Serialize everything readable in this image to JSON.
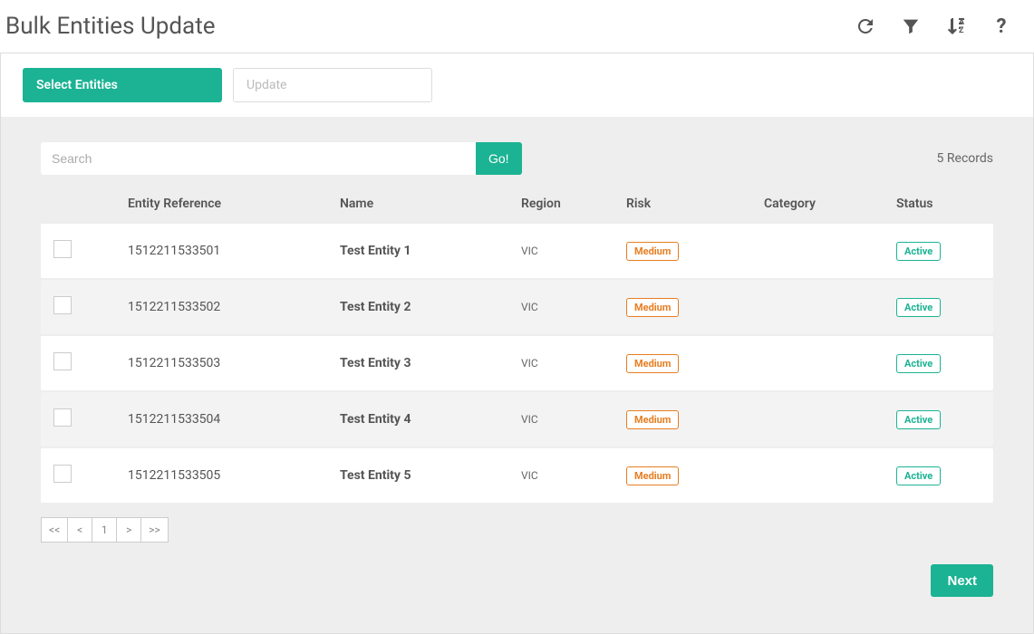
{
  "header": {
    "title": "Bulk Entities Update"
  },
  "tabs": {
    "select": "Select Entities",
    "update": "Update"
  },
  "search": {
    "placeholder": "Search",
    "go_label": "Go!"
  },
  "records_text": "5 Records",
  "columns": {
    "entity_reference": "Entity Reference",
    "name": "Name",
    "region": "Region",
    "risk": "Risk",
    "category": "Category",
    "status": "Status"
  },
  "rows": [
    {
      "ref": "1512211533501",
      "name": "Test Entity 1",
      "region": "VIC",
      "risk": "Medium",
      "category": "",
      "status": "Active"
    },
    {
      "ref": "1512211533502",
      "name": "Test Entity 2",
      "region": "VIC",
      "risk": "Medium",
      "category": "",
      "status": "Active"
    },
    {
      "ref": "1512211533503",
      "name": "Test Entity 3",
      "region": "VIC",
      "risk": "Medium",
      "category": "",
      "status": "Active"
    },
    {
      "ref": "1512211533504",
      "name": "Test Entity 4",
      "region": "VIC",
      "risk": "Medium",
      "category": "",
      "status": "Active"
    },
    {
      "ref": "1512211533505",
      "name": "Test Entity 5",
      "region": "VIC",
      "risk": "Medium",
      "category": "",
      "status": "Active"
    }
  ],
  "pagination": {
    "first": "<<",
    "prev": "<",
    "page": "1",
    "next": ">",
    "last": ">>"
  },
  "next_button": "Next",
  "icons": {
    "refresh": "refresh",
    "filter": "filter",
    "sort": "sort",
    "help": "?"
  }
}
